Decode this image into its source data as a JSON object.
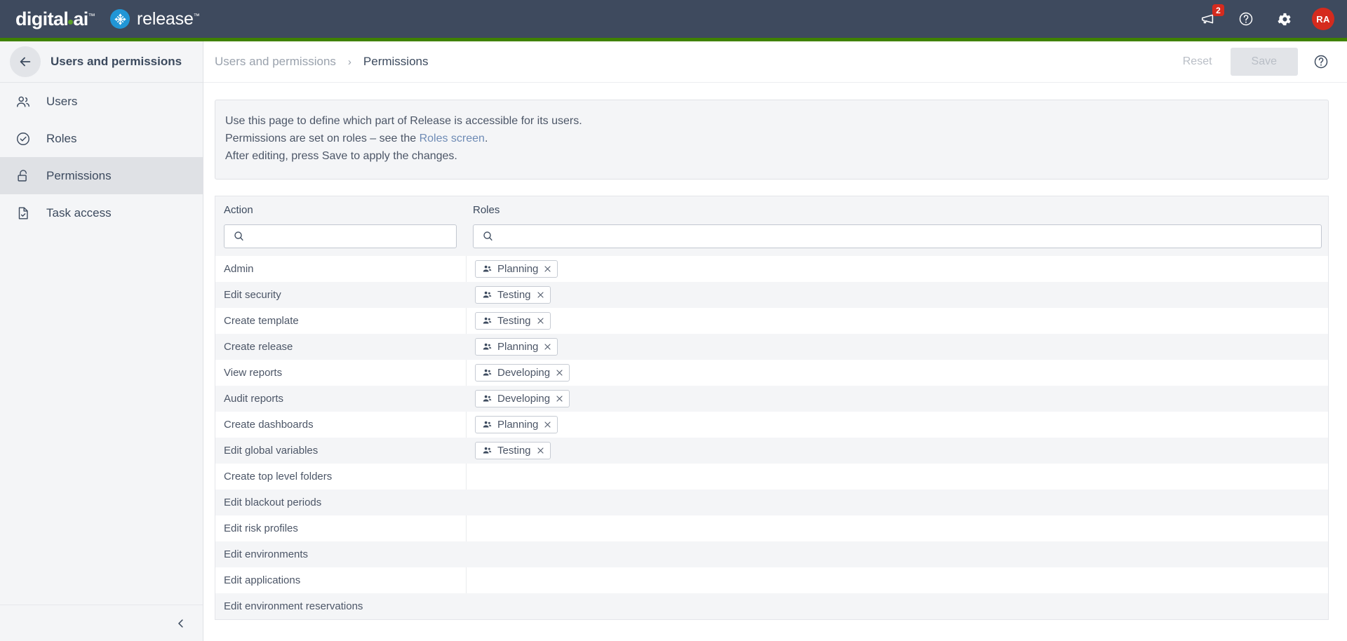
{
  "navbar": {
    "brand_digital": "digital.ai",
    "brand_release": "release",
    "notifications_icon": "megaphone-icon",
    "notifications_badge": "2",
    "help_icon": "question-circle-icon",
    "settings_icon": "gear-icon",
    "avatar_initials": "RA"
  },
  "sidebar": {
    "back_icon": "arrow-left-icon",
    "title": "Users and permissions",
    "items": [
      {
        "label": "Users",
        "icon": "users-icon",
        "active": false
      },
      {
        "label": "Roles",
        "icon": "check-circle-icon",
        "active": false
      },
      {
        "label": "Permissions",
        "icon": "lock-icon",
        "active": true
      },
      {
        "label": "Task access",
        "icon": "file-check-icon",
        "active": false
      }
    ],
    "collapse_icon": "chevron-left-icon"
  },
  "header": {
    "breadcrumb_parent": "Users and permissions",
    "breadcrumb_separator": "›",
    "breadcrumb_current": "Permissions",
    "reset_label": "Reset",
    "save_label": "Save",
    "help_icon": "question-circle-icon"
  },
  "info": {
    "line1": "Use this page to define which part of Release is accessible for its users.",
    "line2_pre": "Permissions are set on roles – see the ",
    "line2_link": "Roles screen",
    "line2_post": ".",
    "line3": "After editing, press Save to apply the changes."
  },
  "table": {
    "columns": [
      {
        "key": "action",
        "label": "Action"
      },
      {
        "key": "roles",
        "label": "Roles"
      }
    ],
    "filters": {
      "action": {
        "value": "",
        "placeholder": "",
        "icon": "search-icon"
      },
      "roles": {
        "value": "",
        "placeholder": "",
        "icon": "search-icon"
      }
    },
    "chip_icon": "group-icon",
    "chip_remove_icon": "close-icon",
    "rows": [
      {
        "action": "Admin",
        "roles": [
          "Planning"
        ]
      },
      {
        "action": "Edit security",
        "roles": [
          "Testing"
        ]
      },
      {
        "action": "Create template",
        "roles": [
          "Testing"
        ]
      },
      {
        "action": "Create release",
        "roles": [
          "Planning"
        ]
      },
      {
        "action": "View reports",
        "roles": [
          "Developing"
        ]
      },
      {
        "action": "Audit reports",
        "roles": [
          "Developing"
        ]
      },
      {
        "action": "Create dashboards",
        "roles": [
          "Planning"
        ]
      },
      {
        "action": "Edit global variables",
        "roles": [
          "Testing"
        ]
      },
      {
        "action": "Create top level folders",
        "roles": []
      },
      {
        "action": "Edit blackout periods",
        "roles": []
      },
      {
        "action": "Edit risk profiles",
        "roles": []
      },
      {
        "action": "Edit environments",
        "roles": []
      },
      {
        "action": "Edit applications",
        "roles": []
      },
      {
        "action": "Edit environment reservations",
        "roles": []
      }
    ]
  },
  "colors": {
    "navbar_bg": "#3e4a5e",
    "accent_green": "#3f8200",
    "brand_blue": "#2196d6",
    "badge_red": "#d52b1e",
    "sidebar_bg": "#f4f5f7",
    "sidebar_active": "#dfe1e5",
    "text_primary": "#3c4a5e",
    "link_blue": "#6e8bb5"
  }
}
